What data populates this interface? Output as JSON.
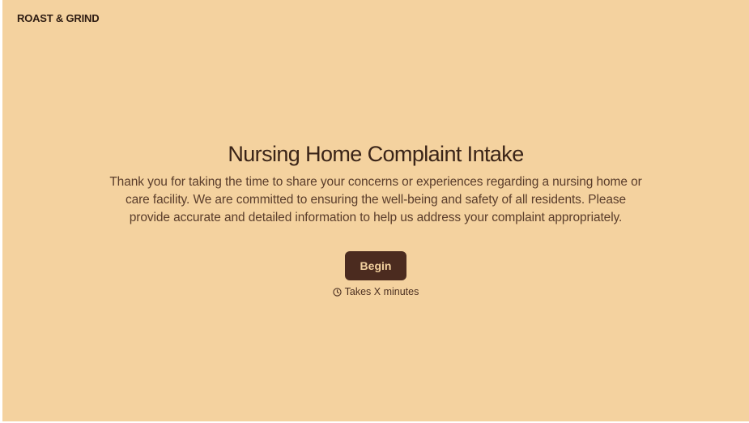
{
  "header": {
    "brand": "ROAST & GRIND"
  },
  "intro": {
    "title": "Nursing Home Complaint Intake",
    "description": "Thank you for taking the time to share your concerns or experiences regarding a nursing home or care facility. We are committed to ensuring the well-being and safety of all residents. Please provide accurate and detailed information to help us address your complaint appropriately.",
    "begin_label": "Begin",
    "duration_icon": "clock-icon",
    "duration_text": "Takes X minutes"
  },
  "colors": {
    "background": "#f4d29f",
    "button": "#4b2b1f",
    "text": "#3a2418"
  }
}
